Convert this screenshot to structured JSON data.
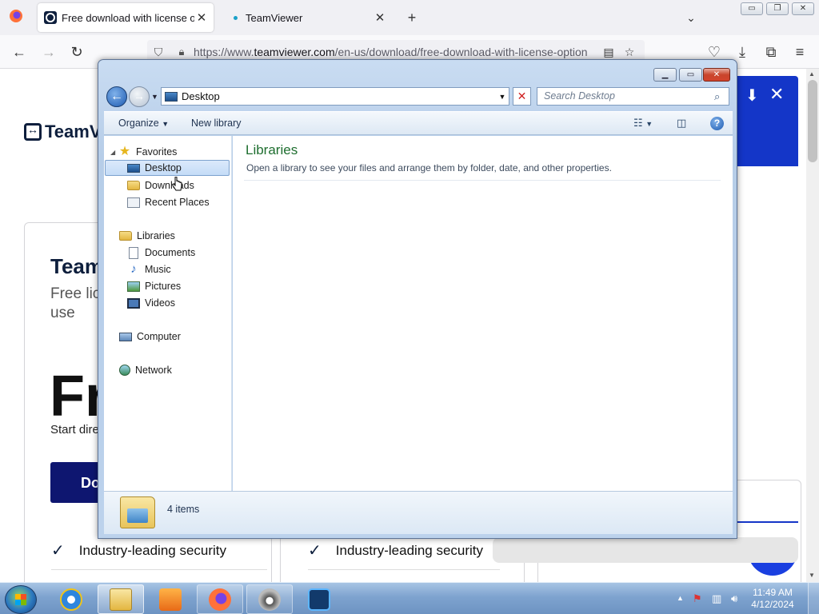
{
  "browser": {
    "tabs": [
      {
        "title": "Free download with license opt",
        "active": true
      },
      {
        "title": "TeamViewer",
        "active": false
      }
    ],
    "new_tab": "+",
    "url_prefix": "https://www.",
    "url_host": "teamviewer.com",
    "url_path": "/en-us/download/free-download-with-license-option"
  },
  "page": {
    "logo": "TeamV",
    "card_title": "Team",
    "card_sub": "Free lic use",
    "big_heading": "Fr",
    "start_text": "Start dire",
    "button_text": "Do",
    "features": [
      "Industry-leading security",
      "Industry-leading security"
    ]
  },
  "explorer": {
    "address": "Desktop",
    "search_placeholder": "Search Desktop",
    "toolbar": {
      "organize": "Organize",
      "new_library": "New library"
    },
    "nav": {
      "favorites": {
        "label": "Favorites",
        "items": [
          "Desktop",
          "Downloads",
          "Recent Places"
        ]
      },
      "libraries": {
        "label": "Libraries",
        "items": [
          "Documents",
          "Music",
          "Pictures",
          "Videos"
        ]
      },
      "computer": "Computer",
      "network": "Network"
    },
    "content": {
      "title": "Libraries",
      "description": "Open a library to see your files and arrange them by folder, date, and other properties."
    },
    "details": {
      "items_count": "4 items"
    }
  },
  "taskbar": {
    "time": "11:49 AM",
    "date": "4/12/2024"
  },
  "colors": {
    "library_title": "#1e6e2f",
    "teamviewer_navy": "#0e1f3d",
    "teamviewer_blue": "#1436c8"
  }
}
